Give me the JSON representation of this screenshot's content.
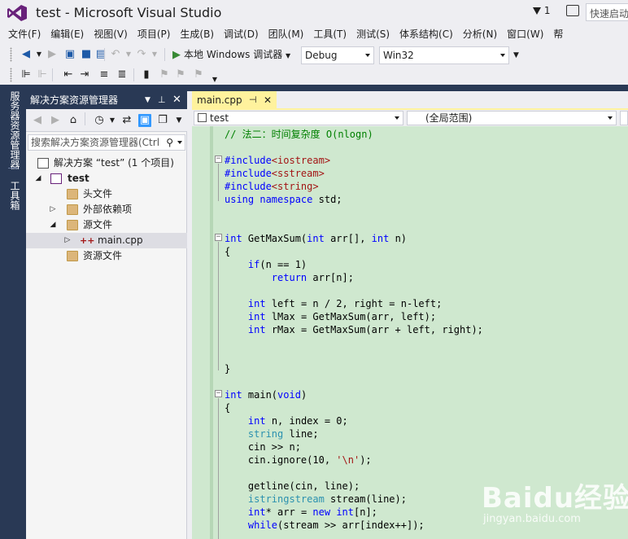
{
  "window": {
    "title": "test - Microsoft Visual Studio",
    "notification_count": "1",
    "quick_launch_placeholder": "快速启动"
  },
  "menu": [
    "文件(F)",
    "编辑(E)",
    "视图(V)",
    "项目(P)",
    "生成(B)",
    "调试(D)",
    "团队(M)",
    "工具(T)",
    "测试(S)",
    "体系结构(C)",
    "分析(N)",
    "窗口(W)",
    "帮"
  ],
  "toolbar": {
    "run_label": "本地 Windows 调试器",
    "configuration": "Debug",
    "platform": "Win32"
  },
  "left_tabs": {
    "server_explorer": "服务器资源管理器",
    "toolbox": "工具箱"
  },
  "solution_explorer": {
    "title": "解决方案资源管理器",
    "search_placeholder": "搜索解决方案资源管理器(Ctrl",
    "tree": [
      {
        "label": "解决方案 “test” (1 个项目)",
        "kind": "solution"
      },
      {
        "label": "test",
        "kind": "project"
      },
      {
        "label": "头文件",
        "kind": "folder"
      },
      {
        "label": "外部依赖项",
        "kind": "external"
      },
      {
        "label": "源文件",
        "kind": "folder"
      },
      {
        "label": "main.cpp",
        "kind": "cpp-file"
      },
      {
        "label": "资源文件",
        "kind": "folder"
      }
    ]
  },
  "editor": {
    "active_tab": "main.cpp",
    "nav_scope": "test",
    "nav_member": "(全局范围)",
    "code_lines": [
      "// 法二：时间复杂度 O(nlogn)",
      "",
      "#include<iostream>",
      "#include<sstream>",
      "#include<string>",
      "using namespace std;",
      "",
      "",
      "int GetMaxSum(int arr[], int n)",
      "{",
      "    if(n == 1)",
      "        return arr[n];",
      "",
      "    int left = n / 2, right = n-left;",
      "    int lMax = GetMaxSum(arr, left);",
      "    int rMax = GetMaxSum(arr + left, right);",
      "",
      "",
      "}",
      "",
      "int main(void)",
      "{",
      "    int n, index = 0;",
      "    string line;",
      "    cin >> n;",
      "    cin.ignore(10, '\\n');",
      "",
      "    getline(cin, line);",
      "    istringstream stream(line);",
      "    int* arr = new int[n];",
      "    while(stream >> arr[index++]);"
    ]
  },
  "watermark": {
    "logo": "Baidu经验",
    "url": "jingyan.baidu.com"
  }
}
